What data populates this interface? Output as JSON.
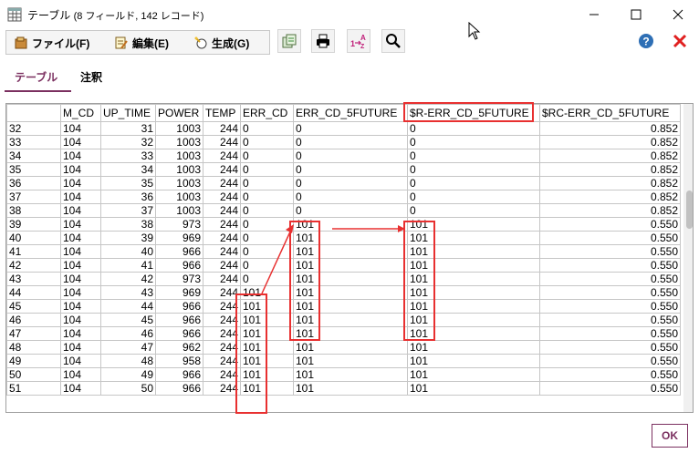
{
  "window": {
    "title": "テーブル",
    "subtitle": "(8 フィールド, 142 レコード)"
  },
  "menu": {
    "file": "ファイル(F)",
    "edit": "編集(E)",
    "generate": "生成(G)"
  },
  "tools": [
    "copy-icon",
    "print-icon",
    "sort-icon",
    "search-icon",
    "help-icon",
    "close-red-icon"
  ],
  "tabs": [
    {
      "label": "テーブル",
      "active": true
    },
    {
      "label": "注釈",
      "active": false
    }
  ],
  "table": {
    "columns": [
      "",
      "M_CD",
      "UP_TIME",
      "POWER",
      "TEMP",
      "ERR_CD",
      "ERR_CD_5FUTURE",
      "$R-ERR_CD_5FUTURE",
      "$RC-ERR_CD_5FUTURE"
    ],
    "rows": [
      [
        "32",
        "104",
        "31",
        "1003",
        "244",
        "0",
        "0",
        "0",
        "0.852"
      ],
      [
        "33",
        "104",
        "32",
        "1003",
        "244",
        "0",
        "0",
        "0",
        "0.852"
      ],
      [
        "34",
        "104",
        "33",
        "1003",
        "244",
        "0",
        "0",
        "0",
        "0.852"
      ],
      [
        "35",
        "104",
        "34",
        "1003",
        "244",
        "0",
        "0",
        "0",
        "0.852"
      ],
      [
        "36",
        "104",
        "35",
        "1003",
        "244",
        "0",
        "0",
        "0",
        "0.852"
      ],
      [
        "37",
        "104",
        "36",
        "1003",
        "244",
        "0",
        "0",
        "0",
        "0.852"
      ],
      [
        "38",
        "104",
        "37",
        "1003",
        "244",
        "0",
        "0",
        "0",
        "0.852"
      ],
      [
        "39",
        "104",
        "38",
        "973",
        "244",
        "0",
        "101",
        "101",
        "0.550"
      ],
      [
        "40",
        "104",
        "39",
        "969",
        "244",
        "0",
        "101",
        "101",
        "0.550"
      ],
      [
        "41",
        "104",
        "40",
        "966",
        "244",
        "0",
        "101",
        "101",
        "0.550"
      ],
      [
        "42",
        "104",
        "41",
        "966",
        "244",
        "0",
        "101",
        "101",
        "0.550"
      ],
      [
        "43",
        "104",
        "42",
        "973",
        "244",
        "0",
        "101",
        "101",
        "0.550"
      ],
      [
        "44",
        "104",
        "43",
        "969",
        "244",
        "101",
        "101",
        "101",
        "0.550"
      ],
      [
        "45",
        "104",
        "44",
        "966",
        "244",
        "101",
        "101",
        "101",
        "0.550"
      ],
      [
        "46",
        "104",
        "45",
        "966",
        "244",
        "101",
        "101",
        "101",
        "0.550"
      ],
      [
        "47",
        "104",
        "46",
        "966",
        "244",
        "101",
        "101",
        "101",
        "0.550"
      ],
      [
        "48",
        "104",
        "47",
        "962",
        "244",
        "101",
        "101",
        "101",
        "0.550"
      ],
      [
        "49",
        "104",
        "48",
        "958",
        "244",
        "101",
        "101",
        "101",
        "0.550"
      ],
      [
        "50",
        "104",
        "49",
        "966",
        "244",
        "101",
        "101",
        "101",
        "0.550"
      ],
      [
        "51",
        "104",
        "50",
        "966",
        "244",
        "101",
        "101",
        "101",
        "0.550"
      ]
    ]
  },
  "footer": {
    "ok_label": "OK"
  },
  "colors": {
    "accent": "#7b3060",
    "highlight": "#e83030",
    "help": "#2e6fb5"
  }
}
